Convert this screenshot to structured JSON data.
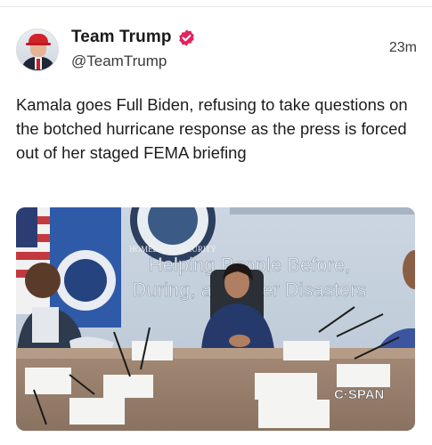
{
  "post": {
    "author_name": "Team Trump",
    "verified": true,
    "handle": "@TeamTrump",
    "timestamp": "23m",
    "text": "Kamala goes Full Biden, refusing to take questions on the botched hurricane response as the press is forced out of her staged FEMA briefing"
  },
  "media": {
    "wall_text_line1": "Helping People Before,",
    "wall_text_line2": "During, and After Disasters",
    "seal_text": "HOMELAND SECURITY",
    "watermark": "C·SPAN"
  },
  "colors": {
    "verified_badge": "#e0245e",
    "avatar_hat": "#d2232a",
    "wall": "#c7d2de"
  },
  "icons": {
    "verified": "verified-badge-icon"
  }
}
